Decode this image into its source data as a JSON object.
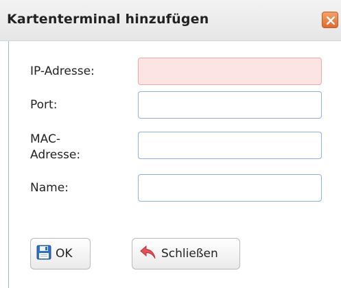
{
  "dialog": {
    "title": "Kartenterminal hinzufügen",
    "close_icon": "close-icon"
  },
  "form": {
    "ip_label": "IP-Adresse:",
    "ip_value": "",
    "ip_invalid": true,
    "port_label": "Port:",
    "port_value": "",
    "mac_label_line1": "MAC-",
    "mac_label_line2": "Adresse:",
    "mac_value": "",
    "name_label": "Name:",
    "name_value": ""
  },
  "buttons": {
    "ok_label": "OK",
    "ok_icon": "save-icon",
    "close_label": "Schließen",
    "close_icon": "undo-arrow-icon"
  },
  "colors": {
    "invalid_bg": "#fde4e4",
    "input_border": "#8fb0dc",
    "close_button": "#e06a2a"
  }
}
